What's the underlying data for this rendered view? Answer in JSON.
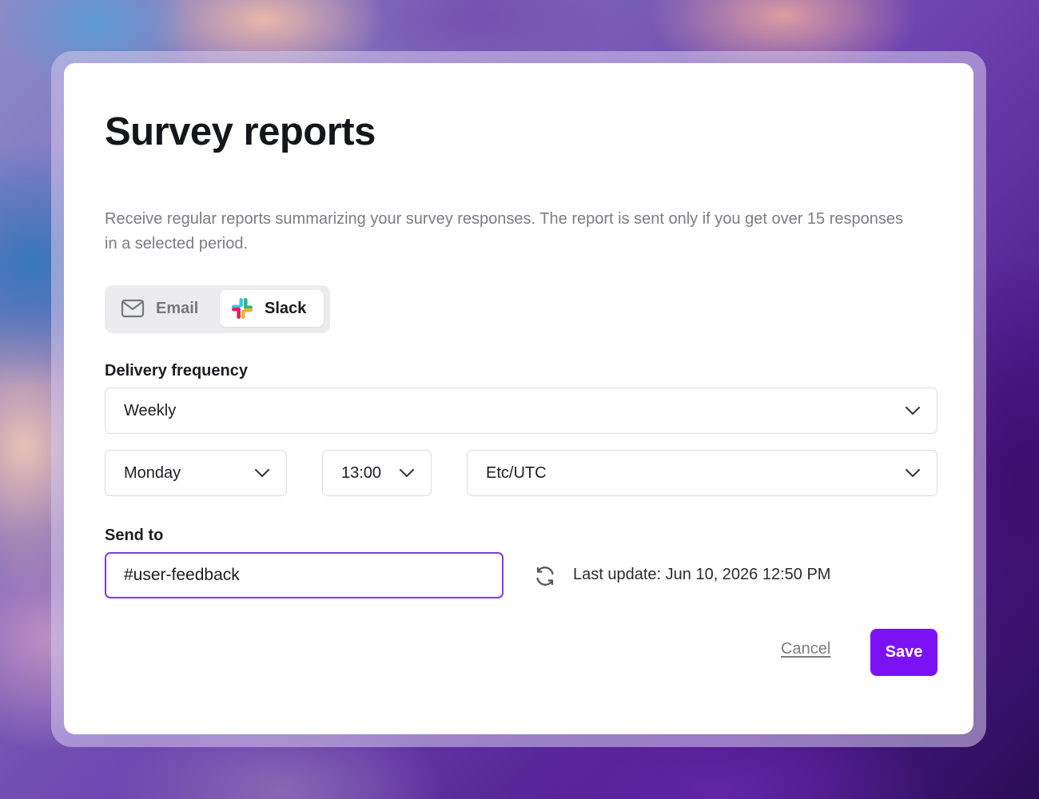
{
  "modal": {
    "title": "Survey reports",
    "description": "Receive regular reports summarizing your survey responses. The report is sent only if you get over 15 responses in a selected period."
  },
  "channels": {
    "email_label": "Email",
    "email_icon": "mail-icon",
    "slack_label": "Slack",
    "slack_icon": "slack-logo-icon",
    "selected": "Slack"
  },
  "delivery": {
    "label": "Delivery frequency",
    "frequency": "Weekly",
    "day": "Monday",
    "time": "13:00",
    "timezone": "Etc/UTC"
  },
  "send_to": {
    "label": "Send to",
    "value": "#user-feedback",
    "refresh_icon": "refresh-icon",
    "last_update": "Last update: Jun 10, 2026 12:50 PM"
  },
  "actions": {
    "cancel_label": "Cancel",
    "save_label": "Save"
  },
  "colors": {
    "accent": "#7b12f6",
    "input_focus_border": "#7e3ee0",
    "muted_text": "#7b7d83",
    "slack_blue": "#36c5f0",
    "slack_green": "#2eb67d",
    "slack_yellow": "#ecb22e",
    "slack_red": "#e01e5a"
  }
}
